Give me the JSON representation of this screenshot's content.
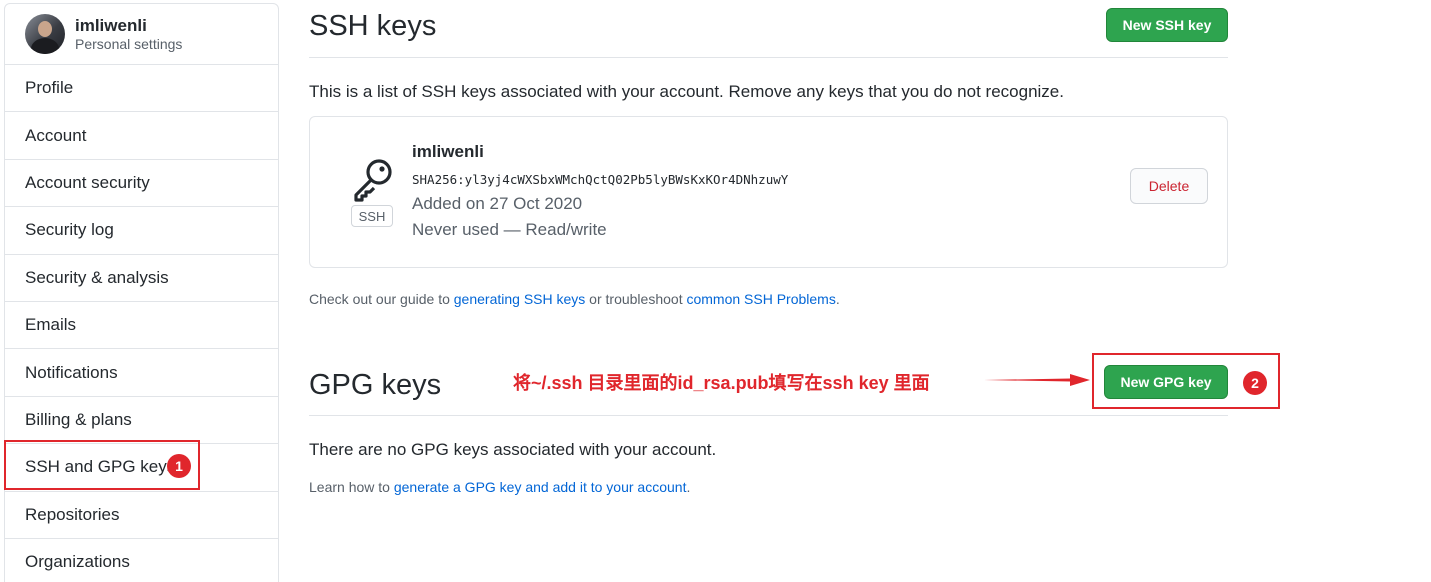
{
  "sidebar": {
    "user": {
      "name": "imliwenli",
      "subtitle": "Personal settings"
    },
    "items": [
      "Profile",
      "Account",
      "Account security",
      "Security log",
      "Security & analysis",
      "Emails",
      "Notifications",
      "Billing & plans",
      "SSH and GPG keys",
      "Repositories",
      "Organizations"
    ]
  },
  "ssh": {
    "title": "SSH keys",
    "new_button": "New SSH key",
    "description": "This is a list of SSH keys associated with your account. Remove any keys that you do not recognize.",
    "key": {
      "title": "imliwenli",
      "fingerprint": "SHA256:yl3yj4cWXSbxWMchQctQ02Pb5lyBWsKxKOr4DNhzuwY",
      "added": "Added on 27 Oct 2020",
      "usage": "Never used — Read/write",
      "type_label": "SSH",
      "delete_label": "Delete"
    },
    "guide": {
      "prefix": "Check out our guide to ",
      "link1": "generating SSH keys",
      "middle": " or troubleshoot ",
      "link2": "common SSH Problems",
      "suffix": "."
    }
  },
  "gpg": {
    "title": "GPG keys",
    "new_button": "New GPG key",
    "empty_text": "There are no GPG keys associated with your account.",
    "learn": {
      "prefix": "Learn how to ",
      "link": "generate a GPG key and add it to your account",
      "suffix": "."
    }
  },
  "annotations": {
    "badge1": "1",
    "badge2": "2",
    "instruction": "将~/.ssh 目录里面的id_rsa.pub填写在ssh key 里面",
    "color": "#e0262c"
  }
}
